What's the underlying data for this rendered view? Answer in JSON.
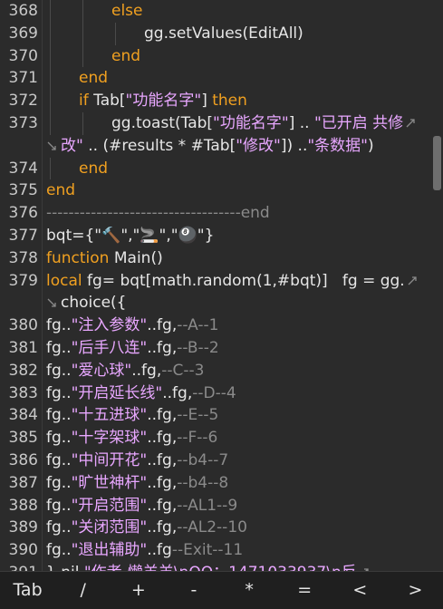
{
  "editor": {
    "lines": [
      {
        "num": "368",
        "indent": 2,
        "tokens": [
          {
            "t": "else",
            "c": "kw"
          }
        ]
      },
      {
        "num": "369",
        "indent": 3,
        "tokens": [
          {
            "t": "gg.setValues(EditAll)",
            "c": "id"
          }
        ]
      },
      {
        "num": "370",
        "indent": 2,
        "tokens": [
          {
            "t": "end",
            "c": "kw"
          }
        ]
      },
      {
        "num": "371",
        "indent": 1,
        "tokens": [
          {
            "t": "end",
            "c": "kw"
          }
        ]
      },
      {
        "num": "372",
        "indent": 1,
        "tokens": [
          {
            "t": "if ",
            "c": "kw"
          },
          {
            "t": "Tab[",
            "c": "id"
          },
          {
            "t": "\"功能名字\"",
            "c": "str"
          },
          {
            "t": "] ",
            "c": "id"
          },
          {
            "t": "then",
            "c": "kw"
          }
        ]
      },
      {
        "num": "373",
        "indent": 2,
        "tokens": [
          {
            "t": "gg.toast(Tab[",
            "c": "id"
          },
          {
            "t": "\"功能名字\"",
            "c": "str"
          },
          {
            "t": "] .. ",
            "c": "id"
          },
          {
            "t": "\"已开启 共修",
            "c": "str"
          }
        ],
        "wrap": true,
        "cont": [
          {
            "t": "改\"",
            "c": "str"
          },
          {
            "t": " .. (#results * #Tab[",
            "c": "id"
          },
          {
            "t": "\"修改\"",
            "c": "str"
          },
          {
            "t": "]) ..",
            "c": "id"
          },
          {
            "t": "\"条数据\"",
            "c": "str"
          },
          {
            "t": ")",
            "c": "id"
          }
        ]
      },
      {
        "num": "374",
        "indent": 1,
        "tokens": [
          {
            "t": "end",
            "c": "kw"
          }
        ]
      },
      {
        "num": "375",
        "indent": 0,
        "tokens": [
          {
            "t": "end",
            "c": "kw"
          }
        ]
      },
      {
        "num": "376",
        "indent": 0,
        "tokens": [
          {
            "t": "-----------------------------------end",
            "c": "cm"
          }
        ]
      },
      {
        "num": "377",
        "indent": 0,
        "tokens": [
          {
            "t": "bqt={\"",
            "c": "id"
          },
          {
            "t": "🔨",
            "c": "str"
          },
          {
            "t": "\",\"",
            "c": "id"
          },
          {
            "t": "🚬",
            "c": "str"
          },
          {
            "t": "\",\"",
            "c": "id"
          },
          {
            "t": "🎱",
            "c": "str"
          },
          {
            "t": "\"}",
            "c": "id"
          }
        ]
      },
      {
        "num": "378",
        "indent": 0,
        "tokens": [
          {
            "t": "function ",
            "c": "kw"
          },
          {
            "t": "Main()",
            "c": "id"
          }
        ]
      },
      {
        "num": "379",
        "indent": 0,
        "tokens": [
          {
            "t": "local ",
            "c": "kw"
          },
          {
            "t": "fg= bqt[math.random(1,#bqt)]   fg = gg.",
            "c": "id"
          }
        ],
        "wrap": true,
        "cont": [
          {
            "t": "choice({",
            "c": "id"
          }
        ]
      },
      {
        "num": "380",
        "indent": 0,
        "tokens": [
          {
            "t": "fg..",
            "c": "id"
          },
          {
            "t": "\"注入参数\"",
            "c": "str"
          },
          {
            "t": "..fg,",
            "c": "id"
          },
          {
            "t": "--A--1",
            "c": "cm"
          }
        ]
      },
      {
        "num": "381",
        "indent": 0,
        "tokens": [
          {
            "t": "fg..",
            "c": "id"
          },
          {
            "t": "\"后手八连\"",
            "c": "str"
          },
          {
            "t": "..fg,",
            "c": "id"
          },
          {
            "t": "--B--2",
            "c": "cm"
          }
        ]
      },
      {
        "num": "382",
        "indent": 0,
        "tokens": [
          {
            "t": "fg..",
            "c": "id"
          },
          {
            "t": "\"爱心球\"",
            "c": "str"
          },
          {
            "t": "..fg,",
            "c": "id"
          },
          {
            "t": "--C--3",
            "c": "cm"
          }
        ]
      },
      {
        "num": "383",
        "indent": 0,
        "tokens": [
          {
            "t": "fg..",
            "c": "id"
          },
          {
            "t": "\"开启延长线\"",
            "c": "str"
          },
          {
            "t": "..fg,",
            "c": "id"
          },
          {
            "t": "--D--4",
            "c": "cm"
          }
        ]
      },
      {
        "num": "384",
        "indent": 0,
        "tokens": [
          {
            "t": "fg..",
            "c": "id"
          },
          {
            "t": "\"十五进球\"",
            "c": "str"
          },
          {
            "t": "..fg,",
            "c": "id"
          },
          {
            "t": "--E--5",
            "c": "cm"
          }
        ]
      },
      {
        "num": "385",
        "indent": 0,
        "tokens": [
          {
            "t": "fg..",
            "c": "id"
          },
          {
            "t": "\"十字架球\"",
            "c": "str"
          },
          {
            "t": "..fg,",
            "c": "id"
          },
          {
            "t": "--F--6",
            "c": "cm"
          }
        ]
      },
      {
        "num": "386",
        "indent": 0,
        "tokens": [
          {
            "t": "fg..",
            "c": "id"
          },
          {
            "t": "\"中间开花\"",
            "c": "str"
          },
          {
            "t": "..fg,",
            "c": "id"
          },
          {
            "t": "--b4--7",
            "c": "cm"
          }
        ]
      },
      {
        "num": "387",
        "indent": 0,
        "tokens": [
          {
            "t": "fg..",
            "c": "id"
          },
          {
            "t": "\"旷世神杆\"",
            "c": "str"
          },
          {
            "t": "..fg,",
            "c": "id"
          },
          {
            "t": "--b4--8",
            "c": "cm"
          }
        ]
      },
      {
        "num": "388",
        "indent": 0,
        "tokens": [
          {
            "t": "fg..",
            "c": "id"
          },
          {
            "t": "\"开启范围\"",
            "c": "str"
          },
          {
            "t": "..fg,",
            "c": "id"
          },
          {
            "t": "--AL1--9",
            "c": "cm"
          }
        ]
      },
      {
        "num": "389",
        "indent": 0,
        "tokens": [
          {
            "t": "fg..",
            "c": "id"
          },
          {
            "t": "\"关闭范围\"",
            "c": "str"
          },
          {
            "t": "..fg,",
            "c": "id"
          },
          {
            "t": "--AL2--10",
            "c": "cm"
          }
        ]
      },
      {
        "num": "390",
        "indent": 0,
        "tokens": [
          {
            "t": "fg..",
            "c": "id"
          },
          {
            "t": "\"退出辅助\"",
            "c": "str"
          },
          {
            "t": "..fg",
            "c": "id"
          },
          {
            "t": "--Exit--11",
            "c": "cm"
          }
        ]
      },
      {
        "num": "391",
        "indent": 0,
        "tokens": [
          {
            "t": "},nil,",
            "c": "id"
          },
          {
            "t": "\"作者-懒羊羊\\nQQ：1471033937\\n反",
            "c": "str"
          }
        ],
        "wrap": true
      }
    ]
  },
  "keybar": {
    "keys": [
      "Tab",
      "/",
      "+",
      "-",
      "*",
      "=",
      "<",
      ">"
    ]
  }
}
